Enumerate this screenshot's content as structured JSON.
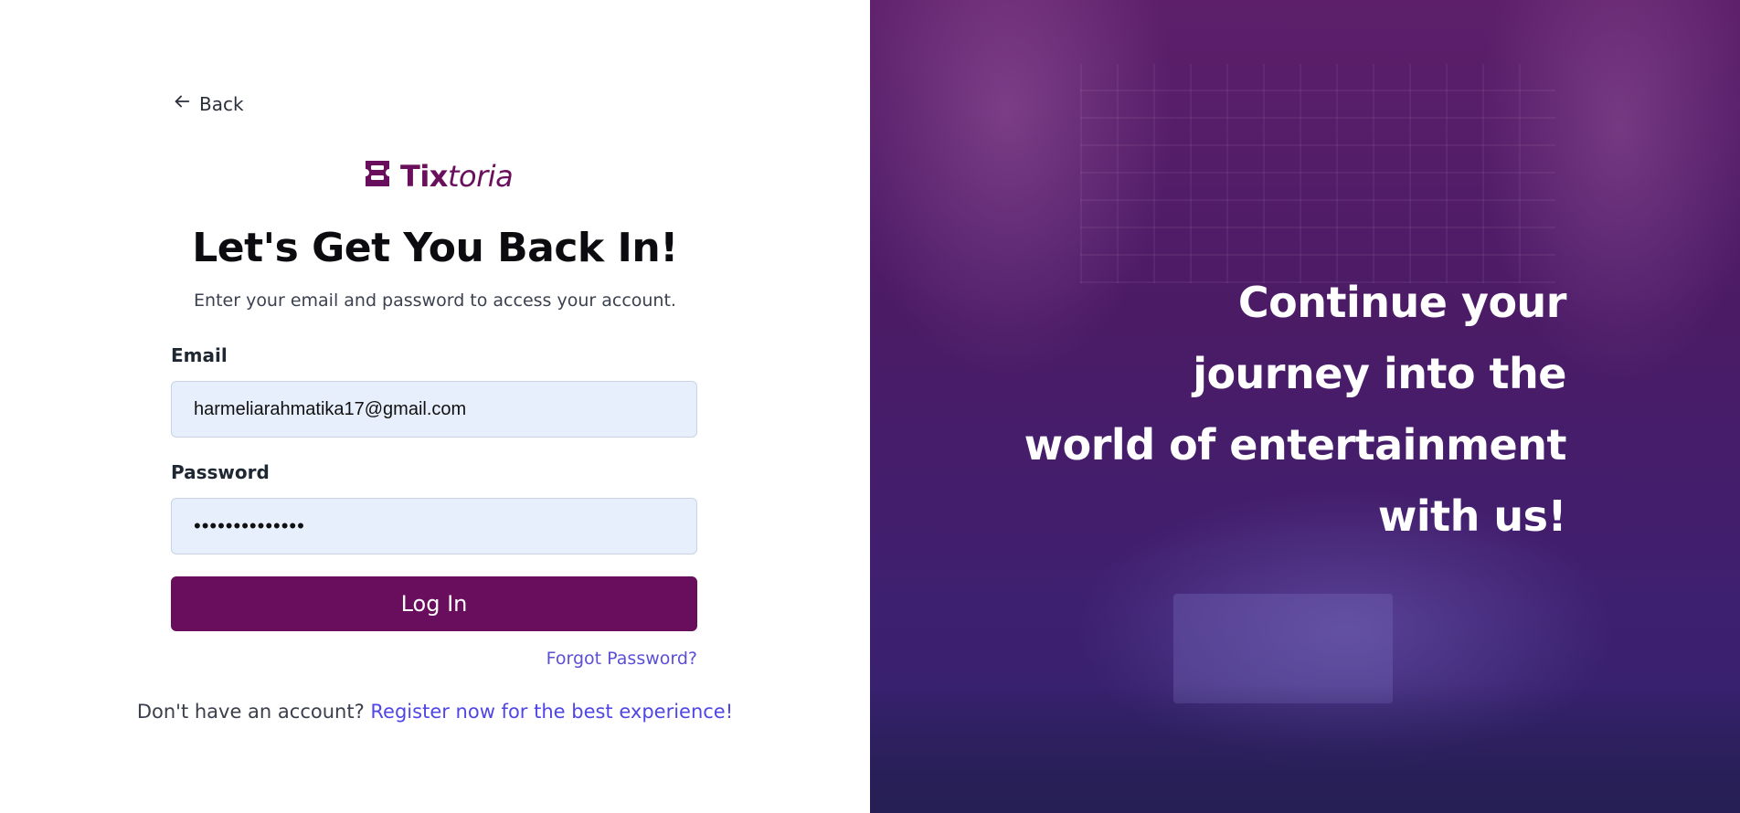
{
  "back": {
    "label": "Back"
  },
  "logo": {
    "bold": "Tix",
    "italic": "toria"
  },
  "heading": {
    "title": "Let's Get You Back In!",
    "subtitle": "Enter your email and password to access your account."
  },
  "form": {
    "email_label": "Email",
    "email_value": "harmeliarahmatika17@gmail.com",
    "password_label": "Password",
    "password_value": "••••••••••••••",
    "login_label": "Log In",
    "forgot_label": "Forgot Password?"
  },
  "register": {
    "prompt": "Don't have an account?",
    "link": "Register now for the best experience!"
  },
  "hero": {
    "lines": [
      "Continue your",
      "journey into the",
      "world of entertainment",
      "with us!"
    ]
  },
  "colors": {
    "brand": "#690e5d",
    "link": "#4f46e5",
    "input_bg": "#e8effc"
  }
}
